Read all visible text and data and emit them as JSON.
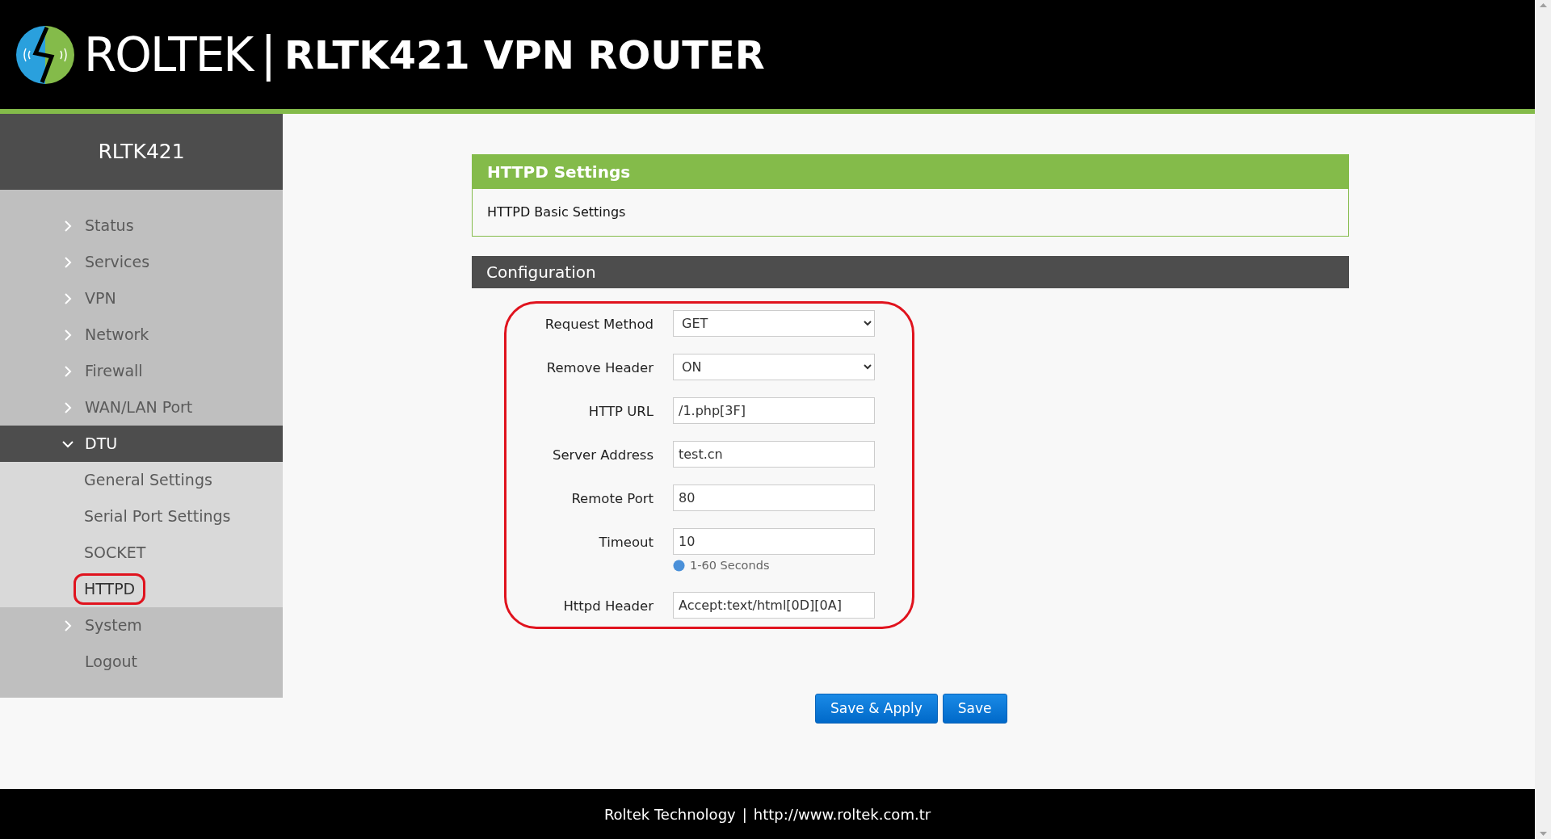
{
  "header": {
    "brand": "ROLTEK",
    "separator": "|",
    "title": "RLTK421 VPN ROUTER"
  },
  "sidebar": {
    "title": "RLTK421",
    "items": [
      {
        "label": "Status",
        "kind": "group",
        "expanded": false
      },
      {
        "label": "Services",
        "kind": "group",
        "expanded": false
      },
      {
        "label": "VPN",
        "kind": "group",
        "expanded": false
      },
      {
        "label": "Network",
        "kind": "group",
        "expanded": false
      },
      {
        "label": "Firewall",
        "kind": "group",
        "expanded": false
      },
      {
        "label": "WAN/LAN Port",
        "kind": "group",
        "expanded": false
      },
      {
        "label": "DTU",
        "kind": "group",
        "expanded": true,
        "children": [
          {
            "label": "General Settings",
            "selected": false,
            "highlighted": false
          },
          {
            "label": "Serial Port Settings",
            "selected": false,
            "highlighted": false
          },
          {
            "label": "SOCKET",
            "selected": false,
            "highlighted": false
          },
          {
            "label": "HTTPD",
            "selected": true,
            "highlighted": true
          }
        ]
      },
      {
        "label": "System",
        "kind": "group",
        "expanded": false
      },
      {
        "label": "Logout",
        "kind": "link"
      }
    ]
  },
  "settings_panel": {
    "title": "HTTPD Settings",
    "description": "HTTPD Basic Settings"
  },
  "configuration": {
    "title": "Configuration",
    "highlighted": true,
    "fields": [
      {
        "label": "Request Method",
        "kind": "select",
        "value": "GET"
      },
      {
        "label": "Remove Header",
        "kind": "select",
        "value": "ON"
      },
      {
        "label": "HTTP URL",
        "kind": "text",
        "value": "/1.php[3F]"
      },
      {
        "label": "Server Address",
        "kind": "text",
        "value": "test.cn"
      },
      {
        "label": "Remote Port",
        "kind": "text",
        "value": "80"
      },
      {
        "label": "Timeout",
        "kind": "text",
        "value": "10",
        "help": "1-60 Seconds"
      },
      {
        "label": "Httpd Header",
        "kind": "text",
        "value": "Accept:text/html[0D][0A]"
      }
    ]
  },
  "buttons": [
    "Save & Apply",
    "Save"
  ],
  "footer": {
    "company": "Roltek Technology",
    "separator": "|",
    "url": "http://www.roltek.com.tr"
  }
}
